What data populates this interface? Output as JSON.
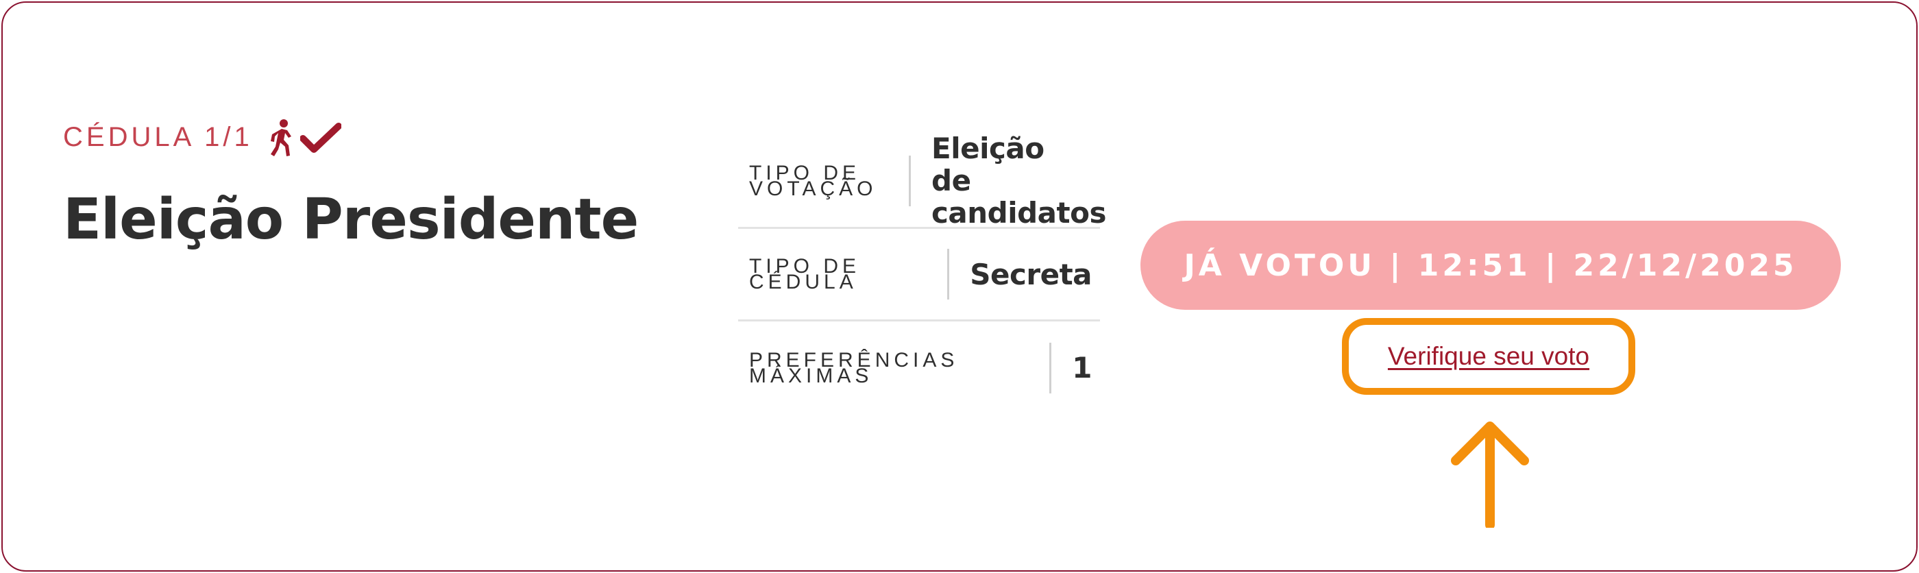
{
  "ballot": {
    "label": "CÉDULA 1/1",
    "title": "Eleição Presidente",
    "voted_icons": [
      "person-walking-icon",
      "checkmark-icon"
    ]
  },
  "info": [
    {
      "key_lines": [
        "TIPO DE",
        "VOTAÇÃO"
      ],
      "value": "Eleição de candidatos"
    },
    {
      "key_lines": [
        "TIPO DE",
        "CÉDULA"
      ],
      "value": "Secreta"
    },
    {
      "key_lines": [
        "PREFERÊNCIAS",
        "MÁXIMAS"
      ],
      "value": "1"
    }
  ],
  "status": {
    "text": "JÁ VOTOU | 12:51 | 22/12/2025"
  },
  "verify": {
    "label": "Verifique seu voto"
  },
  "colors": {
    "border": "#8a1230",
    "accent": "#a01a2c",
    "pill": "#f7a8ab",
    "highlight": "#f4900c"
  },
  "annotation": {
    "icon": "arrow-up-icon"
  }
}
